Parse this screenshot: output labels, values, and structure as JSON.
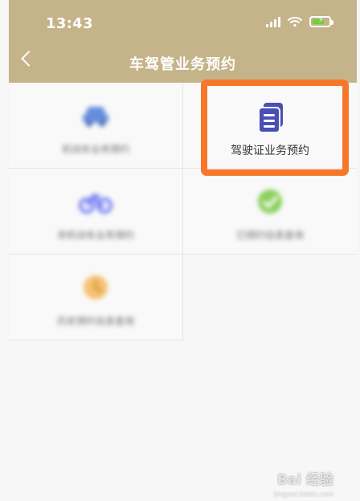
{
  "status_bar": {
    "time": "13:43"
  },
  "nav": {
    "title": "车驾管业务预约"
  },
  "tiles": [
    {
      "label": "机动车业务预约",
      "icon": "car-icon",
      "color": "#4b7bd8",
      "blurred": true
    },
    {
      "label": "驾驶证业务预约",
      "icon": "document-icon",
      "color": "#4a4fb5",
      "blurred": false
    },
    {
      "label": "非机动车业务预约",
      "icon": "bicycle-icon",
      "color": "#5b68f2",
      "blurred": true
    },
    {
      "label": "已预约信息查询",
      "icon": "check-circle-icon",
      "color": "#78c841",
      "blurred": true
    },
    {
      "label": "历史预约信息查询",
      "icon": "clock-icon",
      "color": "#f4b85a",
      "blurred": true
    }
  ],
  "overlay": {
    "highlight_color": "#f7772a"
  },
  "watermark": {
    "text": "Bai 经验",
    "subtext": "jingyan.baidu.com"
  }
}
